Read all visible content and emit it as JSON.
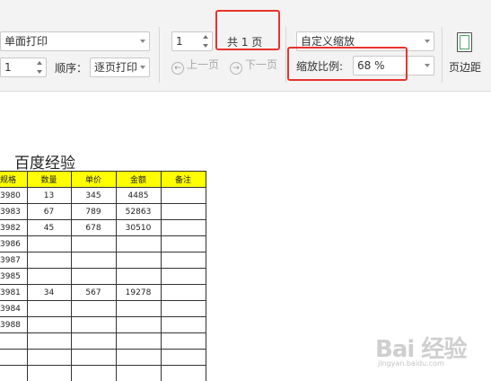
{
  "toolbar": {
    "print_mode": "单面打印",
    "copies": "1",
    "order_label": "顺序：",
    "order_value": "逐页打印",
    "page_input": "1",
    "total_pages": "共 1 页",
    "prev_page": "上一页",
    "next_page": "下一页",
    "zoom_mode": "自定义缩放",
    "zoom_ratio_label": "缩放比例:",
    "zoom_ratio_value": "68 %",
    "margin_label": "页边距"
  },
  "document": {
    "title": "百度经验",
    "columns": [
      "规格",
      "数量",
      "单价",
      "金额",
      "备注"
    ],
    "rows": [
      [
        "3980",
        "13",
        "345",
        "4485",
        ""
      ],
      [
        "3983",
        "67",
        "789",
        "52863",
        ""
      ],
      [
        "3982",
        "45",
        "678",
        "30510",
        ""
      ],
      [
        "3986",
        "",
        "",
        "",
        ""
      ],
      [
        "3987",
        "",
        "",
        "",
        ""
      ],
      [
        "3985",
        "",
        "",
        "",
        ""
      ],
      [
        "3981",
        "34",
        "567",
        "19278",
        ""
      ],
      [
        "3984",
        "",
        "",
        "",
        ""
      ],
      [
        "3988",
        "",
        "",
        "",
        ""
      ],
      [
        "",
        "",
        "",
        "",
        ""
      ],
      [
        "",
        "",
        "",
        "",
        ""
      ],
      [
        "",
        "",
        "",
        "",
        ""
      ]
    ]
  },
  "watermark": {
    "logo": "Bai 经验",
    "url": "jingyan.baidu.com"
  },
  "colors": {
    "header_fill": "#ffff00",
    "highlight": "#e8332c"
  }
}
